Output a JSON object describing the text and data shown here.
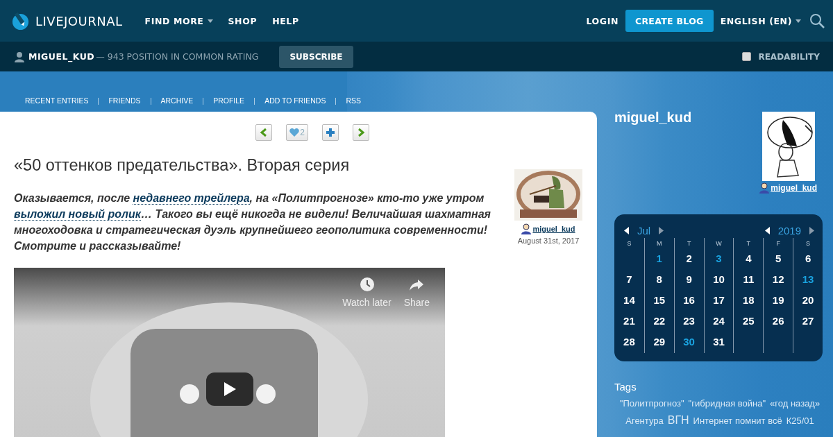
{
  "header": {
    "logo": "LIVEJOURNAL",
    "nav": [
      {
        "label": "FIND MORE",
        "dropdown": true
      },
      {
        "label": "SHOP",
        "dropdown": false
      },
      {
        "label": "HELP",
        "dropdown": false
      }
    ],
    "login": "LOGIN",
    "create_button": "CREATE BLOG",
    "language": "ENGLISH (EN)"
  },
  "user_bar": {
    "username": "MIGUEL_KUD",
    "rating": "— 943 POSITION IN COMMON RATING",
    "subscribe_button": "SUBSCRIBE",
    "readability": {
      "label": "READABILITY",
      "checked": false
    }
  },
  "journal_nav": [
    "RECENT ENTRIES",
    "FRIENDS",
    "ARCHIVE",
    "PROFILE",
    "ADD TO FRIENDS",
    "RSS"
  ],
  "post": {
    "likes": "2",
    "title": "«50 оттенков предательства». Вторая серия",
    "intro": [
      {
        "kind": "text",
        "text": "Оказывается, после "
      },
      {
        "kind": "link",
        "text": "недавнего трейлера"
      },
      {
        "kind": "text",
        "text": ", на «Политпрогнозе» кто-то уже утром "
      },
      {
        "kind": "link",
        "text": "выложил новый ролик"
      },
      {
        "kind": "text",
        "text": "… Такого вы ещё никогда не видели! Величайшая шахматная многоходовка и стратегическая дуэль крупнейшего геополитика современности! Смотрите и рассказывайте!"
      }
    ],
    "author": "miguel_kud",
    "date": "August 31st, 2017",
    "video": {
      "kind": "picture",
      "actions": [
        {
          "kind": "clock",
          "label": "Watch later"
        },
        {
          "kind": "share",
          "label": "Share"
        }
      ]
    }
  },
  "sidebar": {
    "journal_title": "miguel_kud",
    "userpic_name": "miguel_kud",
    "calendar": {
      "month": "Jul",
      "year": "2019",
      "weekdays": [
        "S",
        "M",
        "T",
        "W",
        "T",
        "F",
        "S"
      ],
      "weeks": [
        [
          {
            "kind": "blank"
          },
          {
            "kind": "day",
            "day": "1",
            "linked": true
          },
          {
            "kind": "day",
            "day": "2",
            "linked": false
          },
          {
            "kind": "day",
            "day": "3",
            "linked": true
          },
          {
            "kind": "day",
            "day": "4",
            "linked": false
          },
          {
            "kind": "day",
            "day": "5",
            "linked": false
          },
          {
            "kind": "day",
            "day": "6",
            "linked": false
          }
        ],
        [
          {
            "kind": "day",
            "day": "7",
            "linked": false
          },
          {
            "kind": "day",
            "day": "8",
            "linked": false
          },
          {
            "kind": "day",
            "day": "9",
            "linked": false
          },
          {
            "kind": "day",
            "day": "10",
            "linked": false
          },
          {
            "kind": "day",
            "day": "11",
            "linked": false
          },
          {
            "kind": "day",
            "day": "12",
            "linked": false
          },
          {
            "kind": "day",
            "day": "13",
            "linked": true
          }
        ],
        [
          {
            "kind": "day",
            "day": "14",
            "linked": false
          },
          {
            "kind": "day",
            "day": "15",
            "linked": false
          },
          {
            "kind": "day",
            "day": "16",
            "linked": false
          },
          {
            "kind": "day",
            "day": "17",
            "linked": false
          },
          {
            "kind": "day",
            "day": "18",
            "linked": false
          },
          {
            "kind": "day",
            "day": "19",
            "linked": false
          },
          {
            "kind": "day",
            "day": "20",
            "linked": false
          }
        ],
        [
          {
            "kind": "day",
            "day": "21",
            "linked": false
          },
          {
            "kind": "day",
            "day": "22",
            "linked": false
          },
          {
            "kind": "day",
            "day": "23",
            "linked": false
          },
          {
            "kind": "day",
            "day": "24",
            "linked": false
          },
          {
            "kind": "day",
            "day": "25",
            "linked": false
          },
          {
            "kind": "day",
            "day": "26",
            "linked": false
          },
          {
            "kind": "day",
            "day": "27",
            "linked": false
          }
        ],
        [
          {
            "kind": "day",
            "day": "28",
            "linked": false
          },
          {
            "kind": "day",
            "day": "29",
            "linked": false
          },
          {
            "kind": "day",
            "day": "30",
            "linked": true
          },
          {
            "kind": "day",
            "day": "31",
            "linked": false
          },
          {
            "kind": "blank"
          },
          {
            "kind": "blank"
          },
          {
            "kind": "blank"
          }
        ]
      ]
    },
    "tags_title": "Tags",
    "tags": [
      {
        "label": "\"Политпрогноз\"",
        "large": false
      },
      {
        "label": "\"гибридная война\"",
        "large": false
      },
      {
        "label": "«год назад»",
        "large": false
      },
      {
        "label": "Агентура",
        "large": false
      },
      {
        "label": "ВГН",
        "large": true
      },
      {
        "label": "Интернет помнит всё",
        "large": false
      },
      {
        "label": "К25/01",
        "large": false
      }
    ]
  }
}
